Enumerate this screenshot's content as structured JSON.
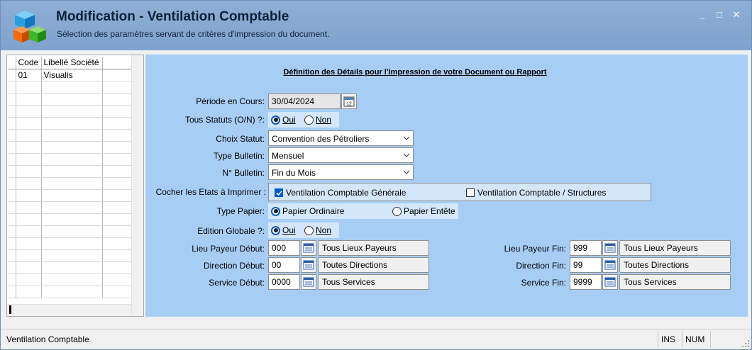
{
  "window": {
    "title": "Modification - Ventilation Comptable",
    "subtitle": "Sélection des paramètres servant de critères d'impression du document.",
    "minimize_glyph": "_",
    "maximize_glyph": "□",
    "close_glyph": "✕"
  },
  "grid": {
    "columns": [
      "Code",
      "Libellé Société"
    ],
    "rows": [
      {
        "code": "01",
        "libelle": "Visualis"
      }
    ]
  },
  "form": {
    "section_title": "Définition des Détails pour l'Impression de votre Document ou Rapport",
    "periode": {
      "label": "Période en Cours:",
      "value": "30/04/2024"
    },
    "tous_statuts": {
      "label": "Tous Statuts (O/N) ?:",
      "options": [
        "Oui",
        "Non"
      ],
      "selected": "Oui"
    },
    "choix_statut": {
      "label": "Choix Statut:",
      "value": "Convention des Pétroliers"
    },
    "type_bulletin": {
      "label": "Type Bulletin:",
      "value": "Mensuel"
    },
    "num_bulletin": {
      "label": "N° Bulletin:",
      "value": "Fin du Mois"
    },
    "etats": {
      "label": "Cocher les Etats à Imprimer :",
      "items": [
        {
          "label": "Ventilation Comptable Générale",
          "checked": true
        },
        {
          "label": "Ventilation Comptable / Structures",
          "checked": false
        }
      ]
    },
    "type_papier": {
      "label": "Type Papier:",
      "options": [
        "Papier Ordinaire",
        "Papier Entête"
      ],
      "selected": "Papier Ordinaire"
    },
    "edition_globale": {
      "label": "Edition Globale ?:",
      "options": [
        "Oui",
        "Non"
      ],
      "selected": "Oui"
    },
    "lieu_payeur_debut": {
      "label": "Lieu Payeur Début:",
      "code": "000",
      "desc": "Tous Lieux Payeurs"
    },
    "direction_debut": {
      "label": "Direction Début:",
      "code": "00",
      "desc": "Toutes Directions"
    },
    "service_debut": {
      "label": "Service Début:",
      "code": "0000",
      "desc": "Tous Services"
    },
    "lieu_payeur_fin": {
      "label": "Lieu Payeur Fin:",
      "code": "999",
      "desc": "Tous Lieux Payeurs"
    },
    "direction_fin": {
      "label": "Direction Fin:",
      "code": "99",
      "desc": "Toutes Directions"
    },
    "service_fin": {
      "label": "Service Fin:",
      "code": "9999",
      "desc": "Tous Services"
    }
  },
  "statusbar": {
    "text": "Ventilation Comptable",
    "ins": "INS",
    "num": "NUM"
  },
  "colors": {
    "titlebar": "#8eafd6",
    "panel": "#a8cdf4",
    "accent": "#0a58c8"
  }
}
